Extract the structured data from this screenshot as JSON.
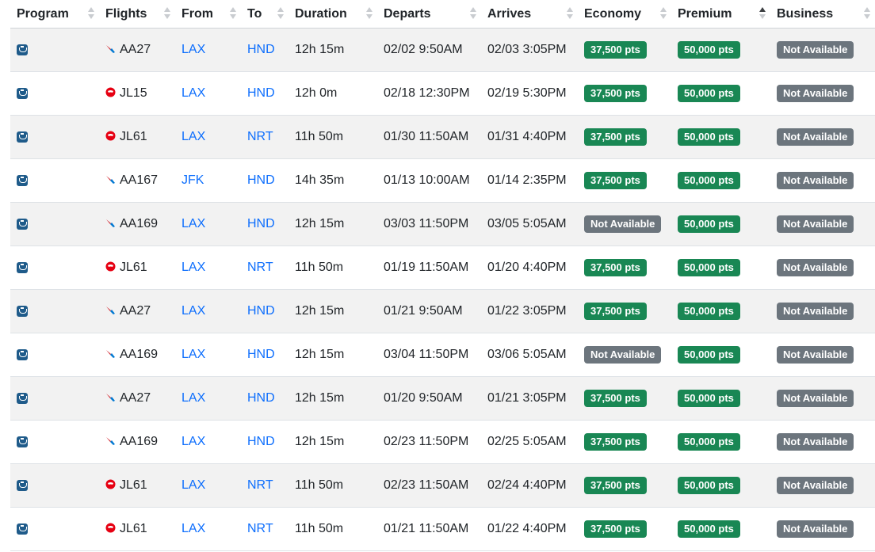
{
  "columns": [
    {
      "key": "program",
      "label": "Program",
      "sort": "none"
    },
    {
      "key": "flights",
      "label": "Flights",
      "sort": "none"
    },
    {
      "key": "from",
      "label": "From",
      "sort": "none"
    },
    {
      "key": "to",
      "label": "To",
      "sort": "none"
    },
    {
      "key": "duration",
      "label": "Duration",
      "sort": "none"
    },
    {
      "key": "departs",
      "label": "Departs",
      "sort": "none"
    },
    {
      "key": "arrives",
      "label": "Arrives",
      "sort": "none"
    },
    {
      "key": "economy",
      "label": "Economy",
      "sort": "none"
    },
    {
      "key": "premium",
      "label": "Premium",
      "sort": "asc"
    },
    {
      "key": "business",
      "label": "Business",
      "sort": "none"
    }
  ],
  "icons": {
    "program": "alaska-airlines-icon",
    "AA": "american-airlines-logo-icon",
    "JL": "japan-airlines-logo-icon"
  },
  "colors": {
    "available": "#198754",
    "not_available": "#6c757d",
    "link": "#0d6efd",
    "aa_red": "#d22630",
    "aa_blue": "#0078d2",
    "jl_red": "#e60012"
  },
  "rows": [
    {
      "airline": "AA",
      "flight": "AA27",
      "from": "LAX",
      "to": "HND",
      "duration": "12h 15m",
      "departs": "02/02 9:50AM",
      "arrives": "02/03 3:05PM",
      "economy": "37,500 pts",
      "premium": "50,000 pts",
      "business": "Not Available"
    },
    {
      "airline": "JL",
      "flight": "JL15",
      "from": "LAX",
      "to": "HND",
      "duration": "12h 0m",
      "departs": "02/18 12:30PM",
      "arrives": "02/19 5:30PM",
      "economy": "37,500 pts",
      "premium": "50,000 pts",
      "business": "Not Available"
    },
    {
      "airline": "JL",
      "flight": "JL61",
      "from": "LAX",
      "to": "NRT",
      "duration": "11h 50m",
      "departs": "01/30 11:50AM",
      "arrives": "01/31 4:40PM",
      "economy": "37,500 pts",
      "premium": "50,000 pts",
      "business": "Not Available"
    },
    {
      "airline": "AA",
      "flight": "AA167",
      "from": "JFK",
      "to": "HND",
      "duration": "14h 35m",
      "departs": "01/13 10:00AM",
      "arrives": "01/14 2:35PM",
      "economy": "37,500 pts",
      "premium": "50,000 pts",
      "business": "Not Available"
    },
    {
      "airline": "AA",
      "flight": "AA169",
      "from": "LAX",
      "to": "HND",
      "duration": "12h 15m",
      "departs": "03/03 11:50PM",
      "arrives": "03/05 5:05AM",
      "economy": "Not Available",
      "premium": "50,000 pts",
      "business": "Not Available"
    },
    {
      "airline": "JL",
      "flight": "JL61",
      "from": "LAX",
      "to": "NRT",
      "duration": "11h 50m",
      "departs": "01/19 11:50AM",
      "arrives": "01/20 4:40PM",
      "economy": "37,500 pts",
      "premium": "50,000 pts",
      "business": "Not Available"
    },
    {
      "airline": "AA",
      "flight": "AA27",
      "from": "LAX",
      "to": "HND",
      "duration": "12h 15m",
      "departs": "01/21 9:50AM",
      "arrives": "01/22 3:05PM",
      "economy": "37,500 pts",
      "premium": "50,000 pts",
      "business": "Not Available"
    },
    {
      "airline": "AA",
      "flight": "AA169",
      "from": "LAX",
      "to": "HND",
      "duration": "12h 15m",
      "departs": "03/04 11:50PM",
      "arrives": "03/06 5:05AM",
      "economy": "Not Available",
      "premium": "50,000 pts",
      "business": "Not Available"
    },
    {
      "airline": "AA",
      "flight": "AA27",
      "from": "LAX",
      "to": "HND",
      "duration": "12h 15m",
      "departs": "01/20 9:50AM",
      "arrives": "01/21 3:05PM",
      "economy": "37,500 pts",
      "premium": "50,000 pts",
      "business": "Not Available"
    },
    {
      "airline": "AA",
      "flight": "AA169",
      "from": "LAX",
      "to": "HND",
      "duration": "12h 15m",
      "departs": "02/23 11:50PM",
      "arrives": "02/25 5:05AM",
      "economy": "37,500 pts",
      "premium": "50,000 pts",
      "business": "Not Available"
    },
    {
      "airline": "JL",
      "flight": "JL61",
      "from": "LAX",
      "to": "NRT",
      "duration": "11h 50m",
      "departs": "02/23 11:50AM",
      "arrives": "02/24 4:40PM",
      "economy": "37,500 pts",
      "premium": "50,000 pts",
      "business": "Not Available"
    },
    {
      "airline": "JL",
      "flight": "JL61",
      "from": "LAX",
      "to": "NRT",
      "duration": "11h 50m",
      "departs": "01/21 11:50AM",
      "arrives": "01/22 4:40PM",
      "economy": "37,500 pts",
      "premium": "50,000 pts",
      "business": "Not Available"
    }
  ]
}
